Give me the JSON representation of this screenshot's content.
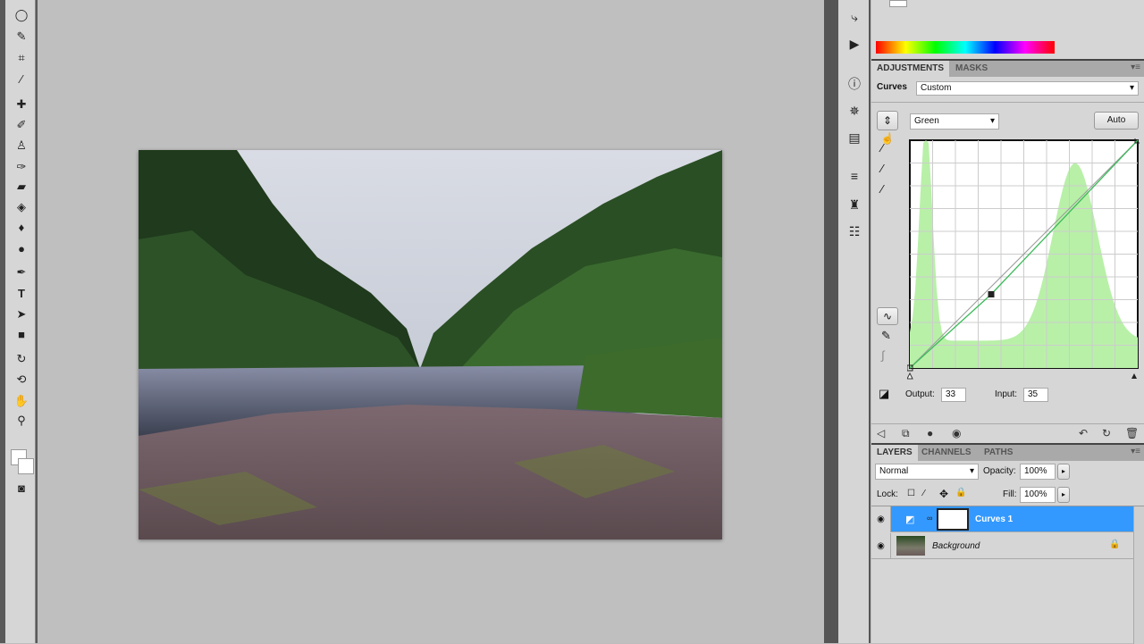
{
  "toolbar": {
    "tools": [
      "marquee",
      "lasso",
      "quick-selection",
      "crop",
      "eyedropper",
      "spot-healing",
      "brush",
      "clone-stamp",
      "history-brush",
      "eraser",
      "paint-bucket",
      "blur",
      "dodge",
      "pen",
      "type",
      "path-selection",
      "rectangle",
      "3d-rotate",
      "3d-orbit",
      "hand",
      "zoom"
    ]
  },
  "adjustments": {
    "tabs": [
      "ADJUSTMENTS",
      "MASKS"
    ],
    "type_label": "Curves",
    "preset": "Custom",
    "channel": "Green",
    "auto_label": "Auto",
    "output_label": "Output:",
    "output_value": "33",
    "input_label": "Input:",
    "input_value": "35",
    "curve_points": [
      [
        0,
        0
      ],
      [
        35,
        33
      ],
      [
        255,
        255
      ]
    ]
  },
  "layers": {
    "tabs": [
      "LAYERS",
      "CHANNELS",
      "PATHS"
    ],
    "blend_mode": "Normal",
    "opacity_label": "Opacity:",
    "opacity": "100%",
    "lock_label": "Lock:",
    "fill_label": "Fill:",
    "fill": "100%",
    "items": [
      {
        "name": "Curves 1",
        "selected": true
      },
      {
        "name": "Background",
        "locked": true
      }
    ]
  },
  "colors": {
    "selection": "#3399ff",
    "histogram": "#b8f0a8",
    "curve": "#3cba5a"
  }
}
